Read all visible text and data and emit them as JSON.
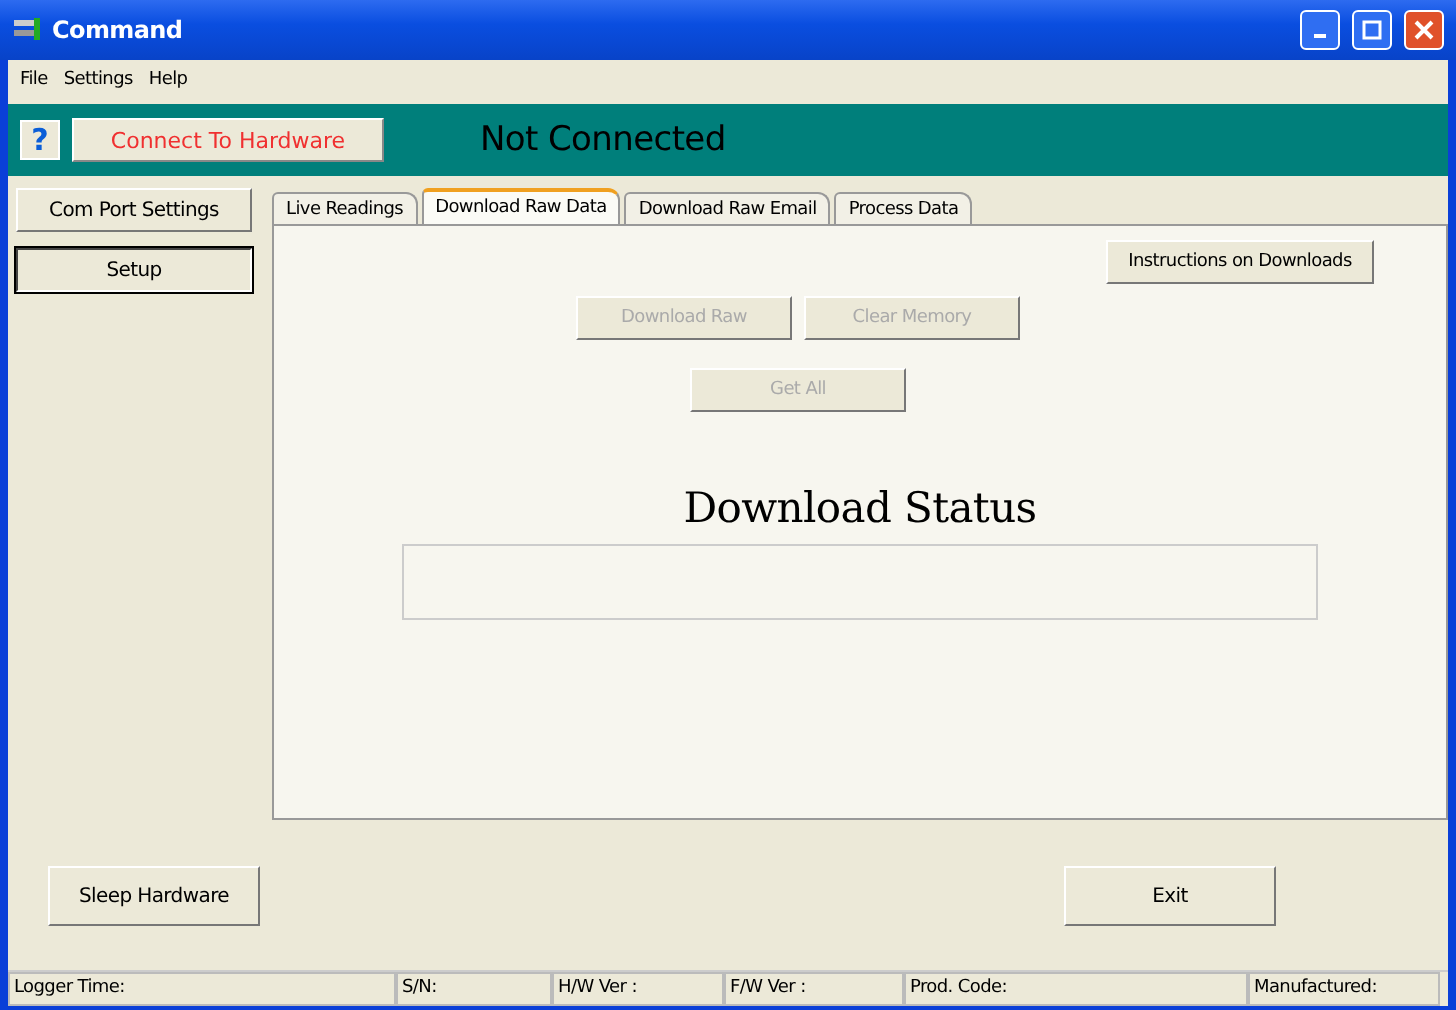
{
  "window": {
    "title": "Command"
  },
  "menu": [
    "File",
    "Settings",
    "Help"
  ],
  "toolbar": {
    "help": "?",
    "connect": "Connect To Hardware",
    "status": "Not Connected"
  },
  "sidebar": [
    {
      "label": "Com Port Settings",
      "selected": false
    },
    {
      "label": "Setup",
      "selected": true
    }
  ],
  "tabs": [
    {
      "label": "Live Readings",
      "selected": false
    },
    {
      "label": "Download Raw Data",
      "selected": true
    },
    {
      "label": "Download Raw Email",
      "selected": false
    },
    {
      "label": "Process Data",
      "selected": false
    }
  ],
  "panel": {
    "instructions": "Instructions on Downloads",
    "actions": [
      {
        "label": "Download Raw",
        "disabled": true
      },
      {
        "label": "Clear Memory",
        "disabled": true
      },
      {
        "label": "Get All",
        "disabled": true
      }
    ],
    "status_title": "Download Status"
  },
  "buttons": {
    "sleep": "Sleep Hardware",
    "exit": "Exit"
  },
  "status_bar": [
    "Logger Time:",
    "S/N:",
    "H/W Ver :",
    "F/W Ver :",
    "Prod. Code:",
    "Manufactured:"
  ]
}
